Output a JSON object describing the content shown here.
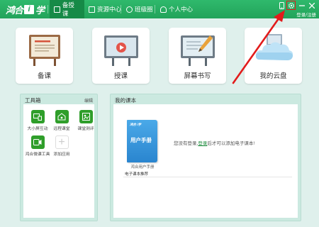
{
  "app": {
    "logo_text": "鸿合",
    "logo_mark": "i",
    "logo_suffix": "学"
  },
  "nav": {
    "tabs": [
      {
        "label": "备授课",
        "icon": "prepare-icon",
        "active": true
      },
      {
        "label": "资源中心",
        "icon": "resource-icon",
        "active": false
      },
      {
        "label": "班级圈",
        "icon": "class-circle-icon",
        "active": false
      },
      {
        "label": "个人中心",
        "icon": "person-icon",
        "active": false
      }
    ],
    "login_label": "登录/注册"
  },
  "features": [
    {
      "label": "备课",
      "icon": "prepare-board-icon"
    },
    {
      "label": "授课",
      "icon": "teach-screen-icon"
    },
    {
      "label": "屏幕书写",
      "icon": "screen-write-icon"
    },
    {
      "label": "我的云盘",
      "icon": "cloud-disk-icon"
    }
  ],
  "toolbox": {
    "title": "工具箱",
    "edit_label": "编辑",
    "tools": [
      {
        "label": "大小屏互动",
        "icon": "screen-interact-icon"
      },
      {
        "label": "远程课堂",
        "icon": "remote-class-icon"
      },
      {
        "label": "课堂测评",
        "icon": "class-test-icon"
      },
      {
        "label": "鸿合微课工具",
        "icon": "micro-lesson-icon"
      },
      {
        "label": "添加应用",
        "icon": "add-icon"
      }
    ]
  },
  "textbooks": {
    "title": "我的课本",
    "book_title": "用户手册",
    "book_logo": "鸿合 i学",
    "book_caption": "鸿合用户手册",
    "empty_prefix": "您没有登录,",
    "empty_link": "登录",
    "empty_suffix": "后才可以添加电子课本!",
    "recommend_label": "电子课本推荐"
  },
  "colors": {
    "brand_green": "#22a35a",
    "panel_bg": "#cbe9e0",
    "annotation_red": "#e21b1b"
  }
}
